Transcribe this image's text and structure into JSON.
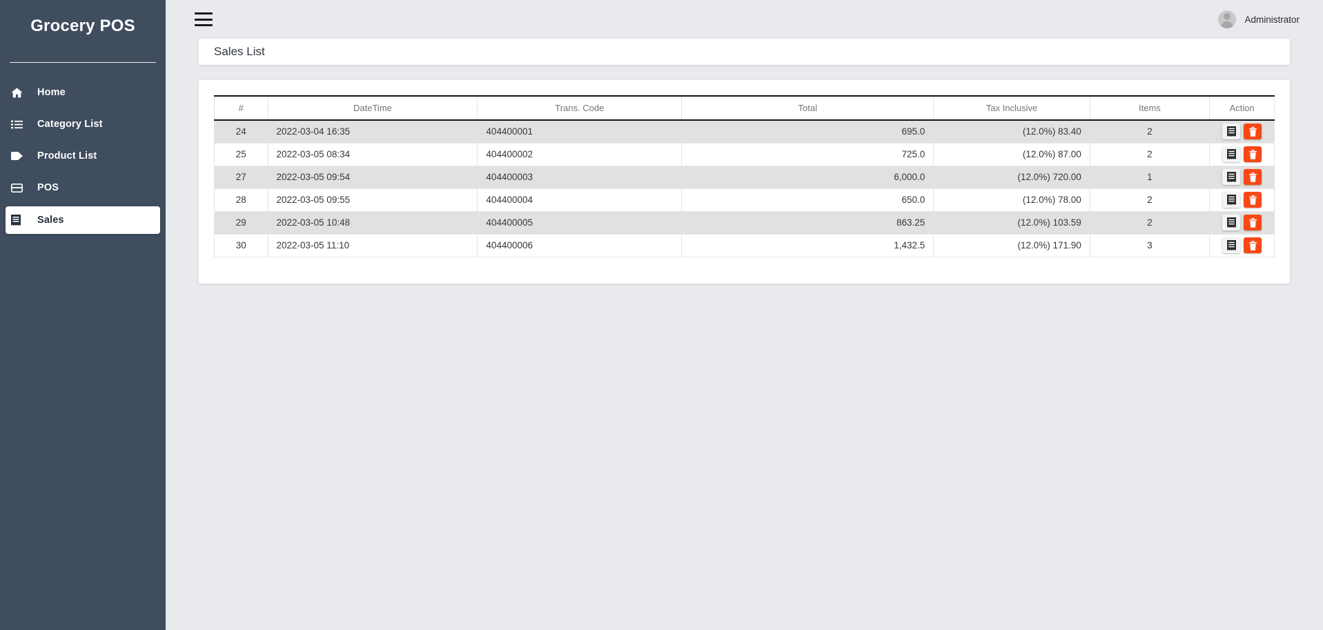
{
  "app": {
    "brand": "Grocery POS",
    "accent_orange": "#f94816",
    "sidebar_bg": "#3f4d5e",
    "page_bg": "#e8eaee"
  },
  "sidebar": {
    "items": [
      {
        "label": "Home",
        "icon": "home-icon",
        "active": false
      },
      {
        "label": "Category List",
        "icon": "list-icon",
        "active": false
      },
      {
        "label": "Product List",
        "icon": "tag-icon",
        "active": false
      },
      {
        "label": "POS",
        "icon": "credit-card-icon",
        "active": false
      },
      {
        "label": "Sales",
        "icon": "receipt-icon",
        "active": true
      }
    ]
  },
  "topbar": {
    "menu_icon": "hamburger-icon",
    "user_name": "Administrator",
    "avatar_icon": "user-avatar-icon"
  },
  "page": {
    "title": "Sales List"
  },
  "table": {
    "columns": [
      "#",
      "DateTime",
      "Trans. Code",
      "Total",
      "Tax Inclusive",
      "Items",
      "Action"
    ],
    "row_actions": {
      "view_label": "view-receipt",
      "delete_label": "delete"
    },
    "rows": [
      {
        "idx": "24",
        "datetime": "2022-03-04 16:35",
        "code": "404400001",
        "total": "695.0",
        "tax": "(12.0%) 83.40",
        "items": "2"
      },
      {
        "idx": "25",
        "datetime": "2022-03-05 08:34",
        "code": "404400002",
        "total": "725.0",
        "tax": "(12.0%) 87.00",
        "items": "2"
      },
      {
        "idx": "27",
        "datetime": "2022-03-05 09:54",
        "code": "404400003",
        "total": "6,000.0",
        "tax": "(12.0%) 720.00",
        "items": "1"
      },
      {
        "idx": "28",
        "datetime": "2022-03-05 09:55",
        "code": "404400004",
        "total": "650.0",
        "tax": "(12.0%) 78.00",
        "items": "2"
      },
      {
        "idx": "29",
        "datetime": "2022-03-05 10:48",
        "code": "404400005",
        "total": "863.25",
        "tax": "(12.0%) 103.59",
        "items": "2"
      },
      {
        "idx": "30",
        "datetime": "2022-03-05 11:10",
        "code": "404400006",
        "total": "1,432.5",
        "tax": "(12.0%) 171.90",
        "items": "3"
      }
    ]
  }
}
